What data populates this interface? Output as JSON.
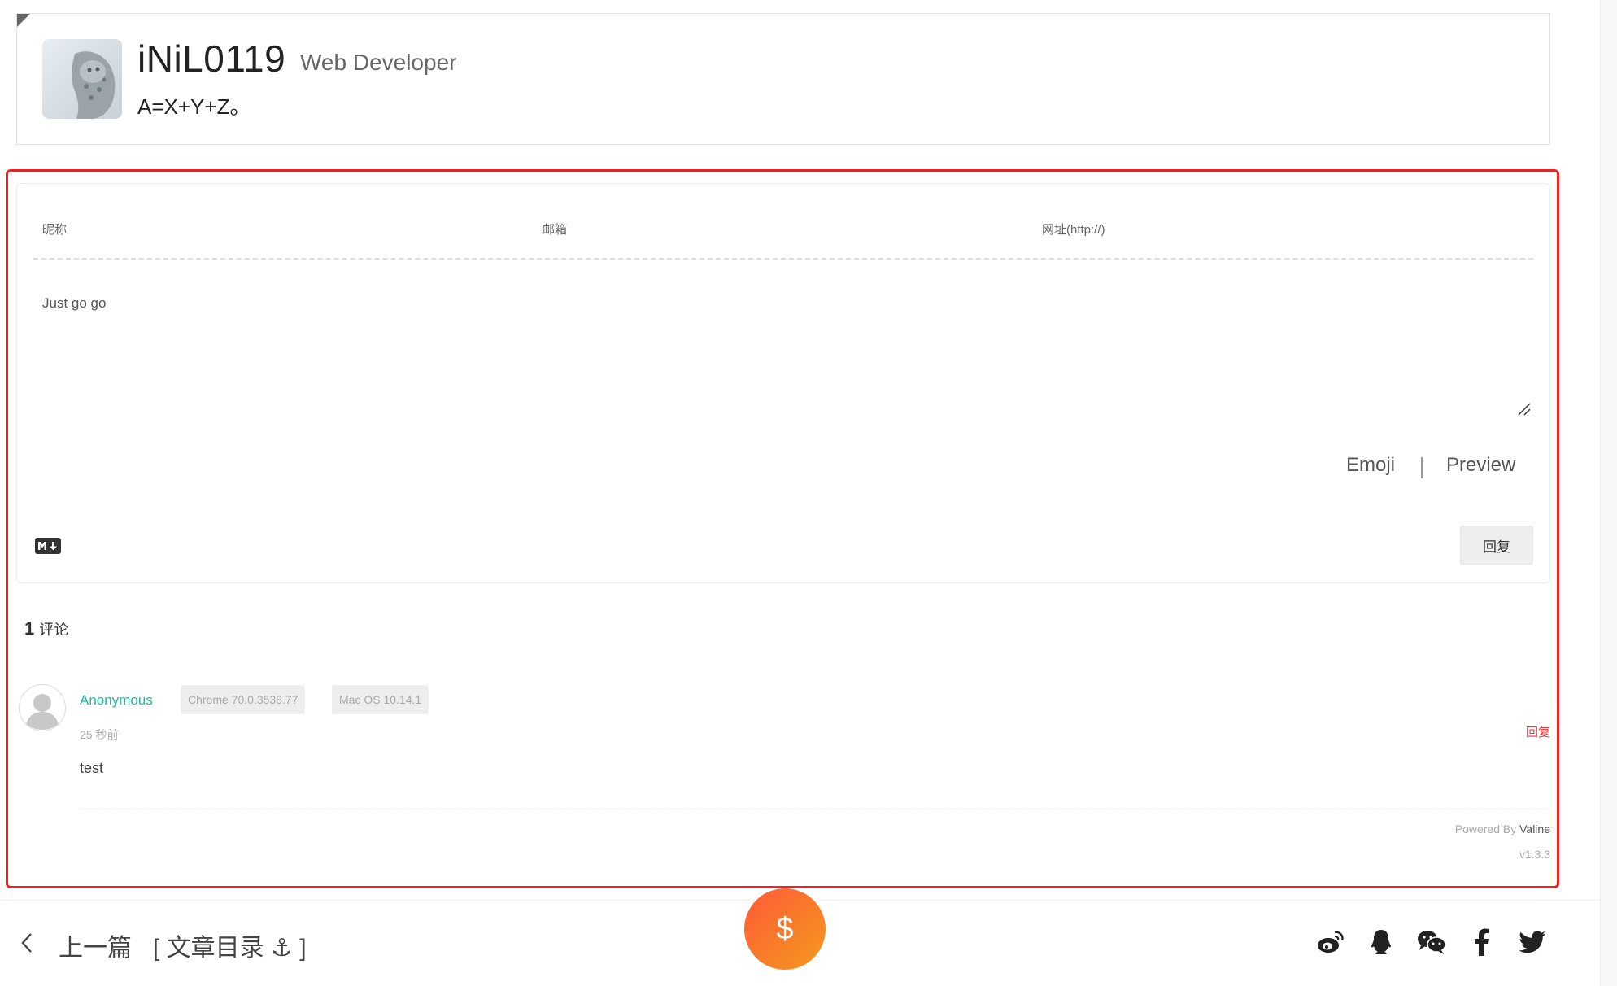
{
  "author": {
    "name": "iNiL0119",
    "role": "Web Developer",
    "motto": "A=X+Y+Z。"
  },
  "comment_form": {
    "nick_placeholder": "昵称",
    "mail_placeholder": "邮箱",
    "link_placeholder": "网址(http://)",
    "content": "Just go go",
    "emoji_label": "Emoji",
    "preview_label": "Preview",
    "submit_label": "回复"
  },
  "comments_header": {
    "count": "1",
    "label": "评论"
  },
  "comments": [
    {
      "nick": "Anonymous",
      "browser": "Chrome 70.0.3538.77",
      "os": "Mac OS 10.14.1",
      "time": "25 秒前",
      "reply_label": "回复",
      "body": "test"
    }
  ],
  "footer_powered": {
    "prefix": "Powered By ",
    "brand": "Valine",
    "version": "v1.3.3"
  },
  "post_nav": {
    "prev_label": "上一篇",
    "toc_label": "[ 文章目录 ⚓ ]",
    "donate_symbol": "$"
  },
  "share_icons": [
    "weibo-icon",
    "qq-icon",
    "wechat-icon",
    "facebook-icon",
    "twitter-icon"
  ],
  "colors": {
    "accent_green": "#1abc9c",
    "reply_red": "#e33333",
    "highlight_red": "#e22222",
    "donate_start": "#ff5a36",
    "donate_end": "#f39a1f"
  }
}
